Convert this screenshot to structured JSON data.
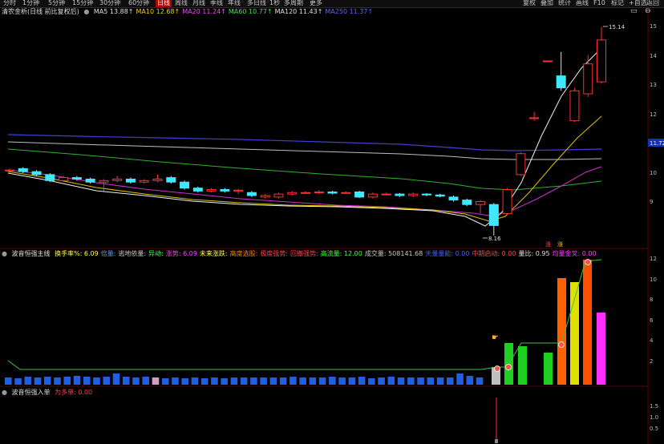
{
  "toolbar": {
    "timeframes": [
      "分时",
      "1分钟",
      "5分钟",
      "15分钟",
      "30分钟",
      "60分钟",
      "日线",
      "周线",
      "月线",
      "季线",
      "年线",
      "多日线",
      "1秒",
      "多周期",
      "更多"
    ],
    "right_buttons": [
      "复权",
      "叠加",
      "统计",
      "画线",
      "F10",
      "标记",
      "+自选",
      "返回"
    ]
  },
  "price_panel": {
    "title": "清农金析(日线 前比复权后)",
    "ma": [
      {
        "label": "MA5",
        "value": "13.88",
        "color": "#e0e0e0"
      },
      {
        "label": "MA10",
        "value": "12.68",
        "color": "#f0d000"
      },
      {
        "label": "MA20",
        "value": "11.24",
        "color": "#ff40ff"
      },
      {
        "label": "MA60",
        "value": "10.77",
        "color": "#40e040"
      },
      {
        "label": "MA120",
        "value": "11.43",
        "color": "#e0e0e0"
      },
      {
        "label": "MA250",
        "value": "11.37",
        "color": "#6060ff"
      }
    ],
    "high_label": "15.14",
    "low_label": "8.16",
    "last_price": "11.72",
    "axis_ticks": [
      "15",
      "14",
      "13",
      "12",
      "11",
      "10",
      "9"
    ],
    "markers": [
      "涨",
      "涨"
    ]
  },
  "indicator_panel": {
    "title": "波音恒强主线",
    "items": [
      {
        "label": "换手率%: 6.09",
        "color": "#ffff40"
      },
      {
        "label": "倍量:",
        "color": "#40a0ff"
      },
      {
        "label": "逃地依量:",
        "color": "#c8c8c8"
      },
      {
        "label": "异动:",
        "color": "#40ff40"
      },
      {
        "label": "涨势: 6.09",
        "color": "#ff40ff"
      },
      {
        "label": "未来涨跌:",
        "color": "#ffff40"
      },
      {
        "label": "高度选股:",
        "color": "#ff8000"
      },
      {
        "label": "极度强势:",
        "color": "#ff4040"
      },
      {
        "label": "回撤强势:",
        "color": "#ff4040"
      },
      {
        "label": "高流量: 12.00",
        "color": "#40ff40"
      },
      {
        "label": "成交量: 508141.68",
        "color": "#c8c8c8"
      },
      {
        "label": "天量量能: 0.00",
        "color": "#4060ff"
      },
      {
        "label": "中期启动: 0.00",
        "color": "#ff4040"
      },
      {
        "label": "量比: 0.95",
        "color": "#e0e0e0"
      },
      {
        "label": "均量金叉: 0.00",
        "color": "#ff40ff"
      }
    ],
    "axis_ticks": [
      "12",
      "10",
      "8",
      "6",
      "4",
      "2"
    ]
  },
  "sub_panel": {
    "title": "波音恒强入单",
    "items": [
      {
        "label": "为多单: 0.00",
        "color": "#ff4040"
      }
    ],
    "axis_ticks": [
      "1.5",
      "1.0",
      "0.5"
    ]
  },
  "colors": {
    "up": "#ff3030",
    "down": "#40e8ff",
    "grid": "#5a0000"
  },
  "chart_data": {
    "type": "candlestick",
    "ylim": [
      8,
      15.5
    ],
    "candles": [
      {
        "o": 10.35,
        "c": 10.35,
        "h": 10.4,
        "l": 10.3
      },
      {
        "o": 10.4,
        "c": 10.3,
        "h": 10.45,
        "l": 10.25
      },
      {
        "o": 10.3,
        "c": 10.2,
        "h": 10.35,
        "l": 10.15
      },
      {
        "o": 10.2,
        "c": 10.0,
        "h": 10.25,
        "l": 9.95
      },
      {
        "o": 10.0,
        "c": 10.1,
        "h": 10.15,
        "l": 9.95
      },
      {
        "o": 10.1,
        "c": 10.05,
        "h": 10.15,
        "l": 10.0
      },
      {
        "o": 10.05,
        "c": 9.95,
        "h": 10.1,
        "l": 9.9
      },
      {
        "o": 9.95,
        "c": 10.0,
        "h": 10.05,
        "l": 9.65
      },
      {
        "o": 10.0,
        "c": 10.05,
        "h": 10.15,
        "l": 9.95
      },
      {
        "o": 10.05,
        "c": 9.95,
        "h": 10.1,
        "l": 9.9
      },
      {
        "o": 9.95,
        "c": 10.0,
        "h": 10.05,
        "l": 9.9
      },
      {
        "o": 10.0,
        "c": 10.05,
        "h": 10.2,
        "l": 9.95
      },
      {
        "o": 10.1,
        "c": 9.95,
        "h": 10.15,
        "l": 9.9
      },
      {
        "o": 9.95,
        "c": 9.75,
        "h": 10.0,
        "l": 9.7
      },
      {
        "o": 9.75,
        "c": 9.65,
        "h": 9.8,
        "l": 9.6
      },
      {
        "o": 9.65,
        "c": 9.7,
        "h": 9.75,
        "l": 9.6
      },
      {
        "o": 9.7,
        "c": 9.65,
        "h": 9.75,
        "l": 9.6
      },
      {
        "o": 9.65,
        "c": 9.68,
        "h": 9.72,
        "l": 9.55
      },
      {
        "o": 9.6,
        "c": 9.5,
        "h": 9.65,
        "l": 9.45
      },
      {
        "o": 9.45,
        "c": 9.5,
        "h": 9.55,
        "l": 9.4
      },
      {
        "o": 9.45,
        "c": 9.55,
        "h": 9.6,
        "l": 9.4
      },
      {
        "o": 9.55,
        "c": 9.6,
        "h": 9.65,
        "l": 9.5
      },
      {
        "o": 9.6,
        "c": 9.6,
        "h": 9.65,
        "l": 9.55
      },
      {
        "o": 9.6,
        "c": 9.62,
        "h": 9.68,
        "l": 9.55
      },
      {
        "o": 9.62,
        "c": 9.58,
        "h": 9.66,
        "l": 9.54
      },
      {
        "o": 9.58,
        "c": 9.6,
        "h": 9.64,
        "l": 9.55
      },
      {
        "o": 9.62,
        "c": 9.45,
        "h": 9.66,
        "l": 9.42
      },
      {
        "o": 9.45,
        "c": 9.55,
        "h": 9.6,
        "l": 9.4
      },
      {
        "o": 9.55,
        "c": 9.55,
        "h": 9.6,
        "l": 9.5
      },
      {
        "o": 9.55,
        "c": 9.5,
        "h": 9.58,
        "l": 9.45
      },
      {
        "o": 9.5,
        "c": 9.55,
        "h": 9.6,
        "l": 9.45
      },
      {
        "o": 9.55,
        "c": 9.52,
        "h": 9.58,
        "l": 9.48
      },
      {
        "o": 9.52,
        "c": 9.48,
        "h": 9.56,
        "l": 9.44
      },
      {
        "o": 9.45,
        "c": 9.35,
        "h": 9.5,
        "l": 9.3
      },
      {
        "o": 9.35,
        "c": 9.2,
        "h": 9.4,
        "l": 9.15
      },
      {
        "o": 9.2,
        "c": 9.3,
        "h": 9.35,
        "l": 8.9
      },
      {
        "o": 9.2,
        "c": 8.5,
        "h": 9.25,
        "l": 8.16
      },
      {
        "o": 8.9,
        "c": 9.7,
        "h": 9.75,
        "l": 8.85
      },
      {
        "o": 10.2,
        "c": 10.9,
        "h": 10.95,
        "l": 10.15
      },
      {
        "o": 12.1,
        "c": 12.1,
        "h": 12.3,
        "l": 12.0
      },
      {
        "o": 14.0,
        "c": 14.0,
        "h": 14.0,
        "l": 14.0
      },
      {
        "o": 13.5,
        "c": 13.1,
        "h": 14.3,
        "l": 13.0
      },
      {
        "o": 12.0,
        "c": 13.0,
        "h": 13.1,
        "l": 11.95
      },
      {
        "o": 12.9,
        "c": 13.9,
        "h": 14.2,
        "l": 12.8
      },
      {
        "o": 13.3,
        "c": 14.7,
        "h": 15.14,
        "l": 13.25
      }
    ]
  }
}
